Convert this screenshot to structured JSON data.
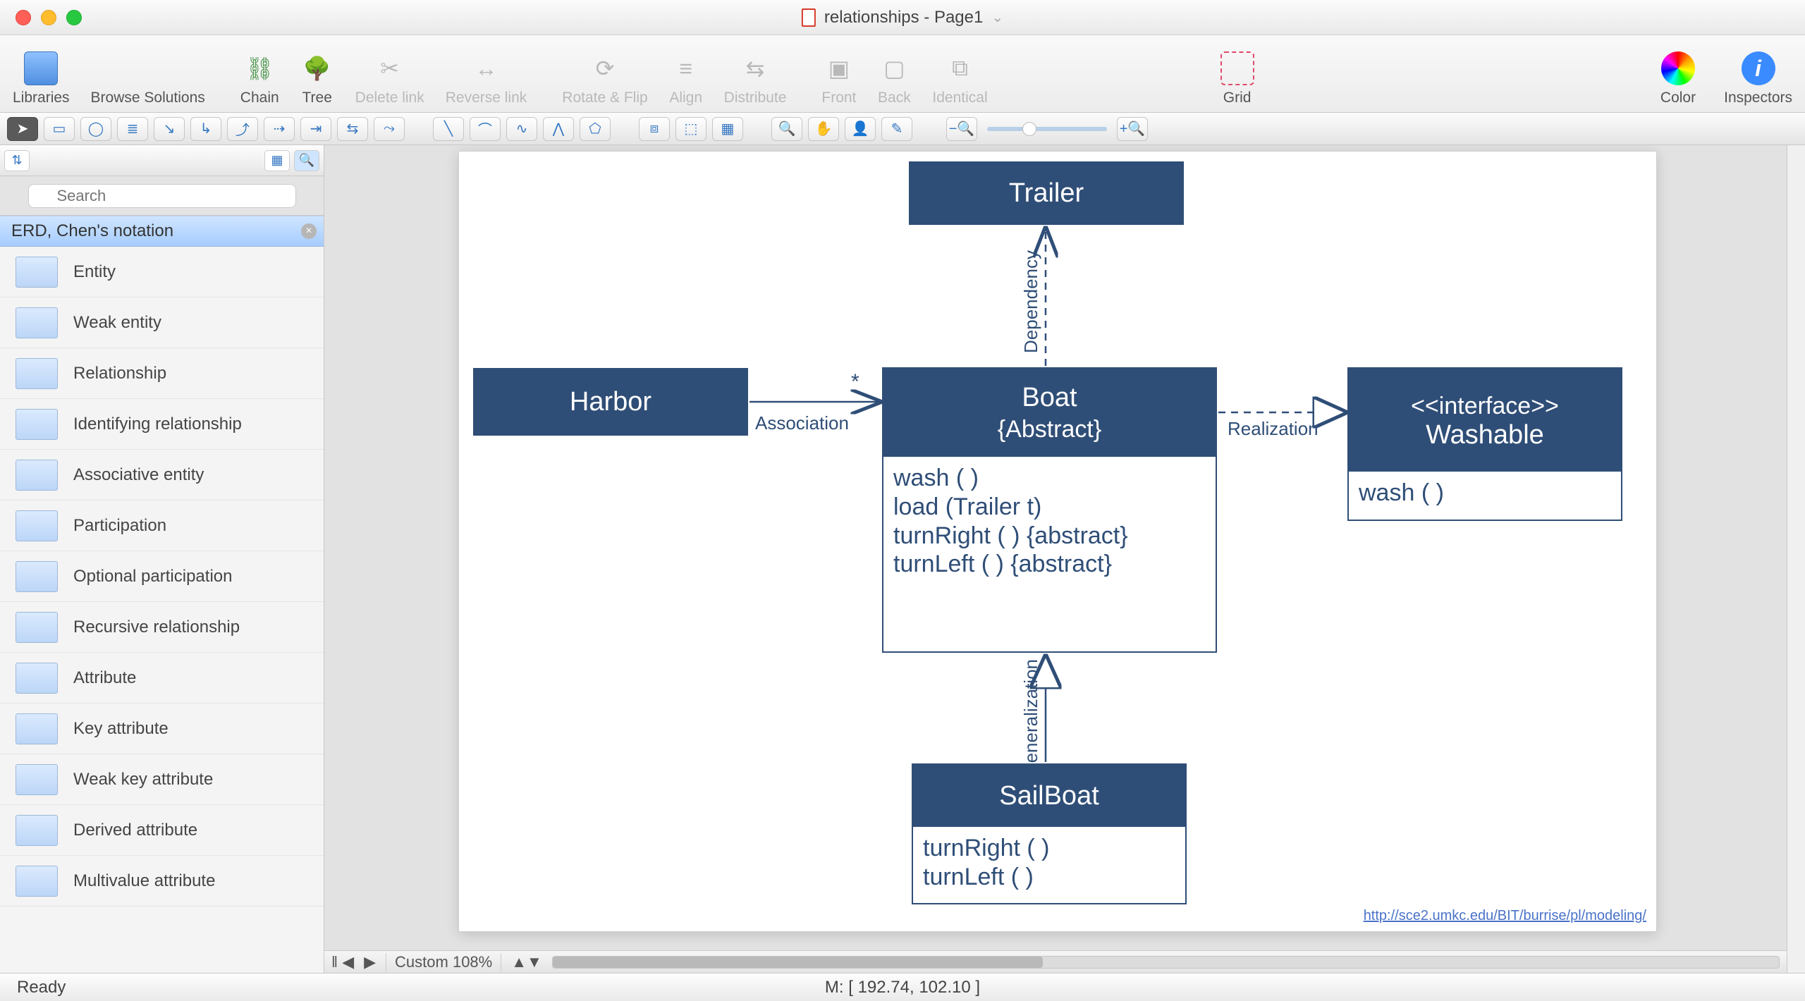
{
  "window": {
    "title": "relationships - Page1"
  },
  "toolbar": {
    "items": [
      {
        "label": "Libraries",
        "icon": "grid-icon",
        "disabled": false
      },
      {
        "label": "Browse Solutions",
        "icon": "palette-icon",
        "disabled": false
      }
    ],
    "group2": [
      {
        "label": "Chain",
        "disabled": false
      },
      {
        "label": "Tree",
        "disabled": false
      },
      {
        "label": "Delete link",
        "disabled": true
      },
      {
        "label": "Reverse link",
        "disabled": true
      }
    ],
    "group3": [
      {
        "label": "Rotate & Flip",
        "disabled": true
      },
      {
        "label": "Align",
        "disabled": true
      },
      {
        "label": "Distribute",
        "disabled": true
      }
    ],
    "group4": [
      {
        "label": "Front",
        "disabled": true
      },
      {
        "label": "Back",
        "disabled": true
      },
      {
        "label": "Identical",
        "disabled": true
      }
    ],
    "group5": [
      {
        "label": "Grid",
        "disabled": false
      }
    ],
    "right": [
      {
        "label": "Color",
        "icon": "color-wheel-icon"
      },
      {
        "label": "Inspectors",
        "icon": "info-icon"
      }
    ]
  },
  "sidebar": {
    "search_placeholder": "Search",
    "library_title": "ERD, Chen's notation",
    "shapes": [
      "Entity",
      "Weak entity",
      "Relationship",
      "Identifying relationship",
      "Associative entity",
      "Participation",
      "Optional participation",
      "Recursive relationship",
      "Attribute",
      "Key attribute",
      "Weak key attribute",
      "Derived attribute",
      "Multivalue attribute"
    ]
  },
  "diagram": {
    "trailer": {
      "title": "Trailer"
    },
    "harbor": {
      "title": "Harbor"
    },
    "boat": {
      "title": "Boat",
      "subtitle": "{Abstract}",
      "ops": [
        "wash ( )",
        "load (Trailer t)",
        "turnRight ( ) {abstract}",
        "turnLeft ( ) {abstract}"
      ]
    },
    "washable": {
      "stereo": "<<interface>>",
      "title": "Washable",
      "ops": [
        "wash ( )"
      ]
    },
    "sailboat": {
      "title": "SailBoat",
      "ops": [
        "turnRight ( )",
        "turnLeft ( )"
      ]
    },
    "labels": {
      "assoc": "Association",
      "mult": "*",
      "dep": "Dependency",
      "real": "Realization",
      "gen": "Generalization"
    },
    "link_text": "http://sce2.umkc.edu/BIT/burrise/pl/modeling/"
  },
  "bottombar": {
    "zoom": "Custom 108%",
    "mouse": "M: [ 192.74, 102.10 ]",
    "status": "Ready"
  }
}
